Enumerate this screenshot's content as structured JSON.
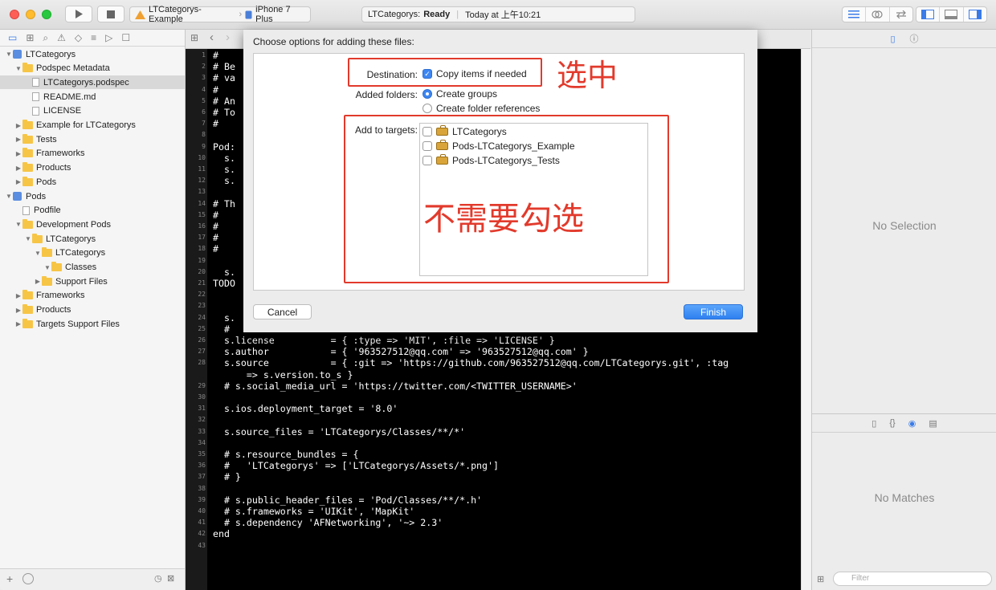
{
  "toolbar": {
    "scheme_name": "LTCategorys-Example",
    "device_name": "iPhone 7 Plus",
    "status_project": "LTCategorys:",
    "status_state": "Ready",
    "status_time": "Today at 上午10:21"
  },
  "navigator": {
    "items": [
      {
        "label": "LTCategorys",
        "kind": "project",
        "indent": 0,
        "open": true
      },
      {
        "label": "Podspec Metadata",
        "kind": "folder",
        "indent": 1,
        "open": true
      },
      {
        "label": "LTCategorys.podspec",
        "kind": "file",
        "indent": 2,
        "selected": true
      },
      {
        "label": "README.md",
        "kind": "file",
        "indent": 2
      },
      {
        "label": "LICENSE",
        "kind": "file",
        "indent": 2
      },
      {
        "label": "Example for LTCategorys",
        "kind": "folder",
        "indent": 1
      },
      {
        "label": "Tests",
        "kind": "folder",
        "indent": 1
      },
      {
        "label": "Frameworks",
        "kind": "folder",
        "indent": 1
      },
      {
        "label": "Products",
        "kind": "folder",
        "indent": 1
      },
      {
        "label": "Pods",
        "kind": "folder",
        "indent": 1
      },
      {
        "label": "Pods",
        "kind": "project",
        "indent": 0,
        "open": true
      },
      {
        "label": "Podfile",
        "kind": "file",
        "indent": 1
      },
      {
        "label": "Development Pods",
        "kind": "folder",
        "indent": 1,
        "open": true
      },
      {
        "label": "LTCategorys",
        "kind": "folder",
        "indent": 2,
        "open": true
      },
      {
        "label": "LTCategorys",
        "kind": "folder",
        "indent": 3,
        "open": true
      },
      {
        "label": "Classes",
        "kind": "folder",
        "indent": 4,
        "open": true
      },
      {
        "label": "Support Files",
        "kind": "folder",
        "indent": 3
      },
      {
        "label": "Frameworks",
        "kind": "folder",
        "indent": 1
      },
      {
        "label": "Products",
        "kind": "folder",
        "indent": 1
      },
      {
        "label": "Targets Support Files",
        "kind": "folder",
        "indent": 1
      }
    ]
  },
  "editor": {
    "lines": [
      {
        "n": "1",
        "t": "#"
      },
      {
        "n": "2",
        "t": "# Be"
      },
      {
        "n": "3",
        "t": "# va"
      },
      {
        "n": "4",
        "t": "#"
      },
      {
        "n": "5",
        "t": "# An"
      },
      {
        "n": "6",
        "t": "# To"
      },
      {
        "n": "7",
        "t": "#"
      },
      {
        "n": "8",
        "t": ""
      },
      {
        "n": "9",
        "t": "Pod:"
      },
      {
        "n": "10",
        "t": "  s."
      },
      {
        "n": "11",
        "t": "  s."
      },
      {
        "n": "12",
        "t": "  s."
      },
      {
        "n": "13",
        "t": ""
      },
      {
        "n": "14",
        "t": "# Th"
      },
      {
        "n": "15",
        "t": "#   "
      },
      {
        "n": "16",
        "t": "#   "
      },
      {
        "n": "17",
        "t": "#   "
      },
      {
        "n": "18",
        "t": "#   "
      },
      {
        "n": "19",
        "t": ""
      },
      {
        "n": "20",
        "t": "  s."
      },
      {
        "n": "21",
        "t": "TODO"
      },
      {
        "n": "22",
        "t": ""
      },
      {
        "n": "23",
        "t": ""
      },
      {
        "n": "24",
        "t": "  s."
      },
      {
        "n": "25",
        "t": "  #"
      },
      {
        "n": "26",
        "t": "  s.license          = { :type => 'MIT', :file => 'LICENSE' }"
      },
      {
        "n": "27",
        "t": "  s.author           = { '963527512@qq.com' => '963527512@qq.com' }"
      },
      {
        "n": "28",
        "t": "  s.source           = { :git => 'https://github.com/963527512@qq.com/LTCategorys.git', :tag"
      },
      {
        "n": "",
        "t": "      => s.version.to_s }"
      },
      {
        "n": "29",
        "t": "  # s.social_media_url = 'https://twitter.com/<TWITTER_USERNAME>'"
      },
      {
        "n": "30",
        "t": ""
      },
      {
        "n": "31",
        "t": "  s.ios.deployment_target = '8.0'"
      },
      {
        "n": "32",
        "t": ""
      },
      {
        "n": "33",
        "t": "  s.source_files = 'LTCategorys/Classes/**/*'"
      },
      {
        "n": "34",
        "t": ""
      },
      {
        "n": "35",
        "t": "  # s.resource_bundles = {"
      },
      {
        "n": "36",
        "t": "  #   'LTCategorys' => ['LTCategorys/Assets/*.png']"
      },
      {
        "n": "37",
        "t": "  # }"
      },
      {
        "n": "38",
        "t": ""
      },
      {
        "n": "39",
        "t": "  # s.public_header_files = 'Pod/Classes/**/*.h'"
      },
      {
        "n": "40",
        "t": "  # s.frameworks = 'UIKit', 'MapKit'"
      },
      {
        "n": "41",
        "t": "  # s.dependency 'AFNetworking', '~> 2.3'"
      },
      {
        "n": "42",
        "t": "end"
      },
      {
        "n": "43",
        "t": ""
      }
    ]
  },
  "inspector": {
    "no_selection": "No Selection",
    "no_matches": "No Matches",
    "filter_placeholder": "Filter"
  },
  "sheet": {
    "title": "Choose options for adding these files:",
    "destination_label": "Destination:",
    "copy_items_label": "Copy items if needed",
    "copy_items_checked": true,
    "added_folders_label": "Added folders:",
    "create_groups_label": "Create groups",
    "create_folder_refs_label": "Create folder references",
    "add_to_targets_label": "Add to targets:",
    "targets": [
      {
        "name": "LTCategorys",
        "checked": false
      },
      {
        "name": "Pods-LTCategorys_Example",
        "checked": false
      },
      {
        "name": "Pods-LTCategorys_Tests",
        "checked": false
      }
    ],
    "cancel_label": "Cancel",
    "finish_label": "Finish"
  },
  "annotations": {
    "select_text": "选中",
    "no_check_text": "不需要勾选",
    "color": "#e23a2c"
  },
  "colors": {
    "accent": "#3d86f2",
    "folder": "#f7c546",
    "editor_bg": "#000000"
  }
}
